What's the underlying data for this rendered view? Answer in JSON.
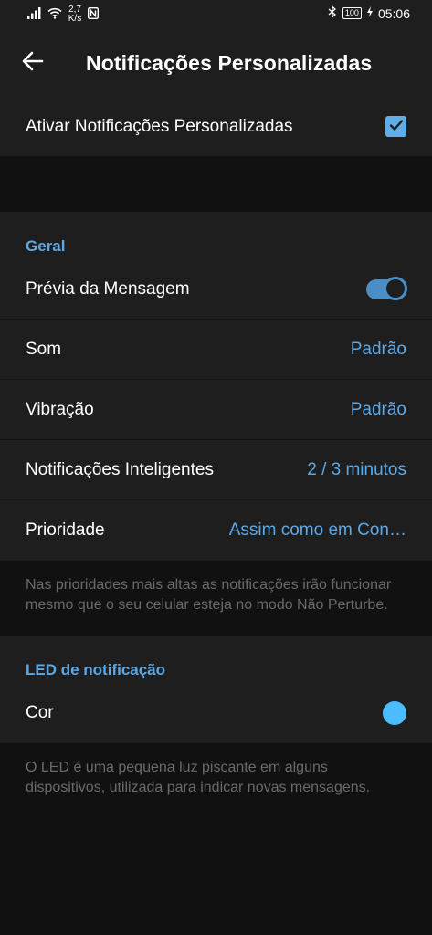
{
  "status": {
    "net_speed_value": "2,7",
    "net_speed_unit": "K/s",
    "battery": "100",
    "time": "05:06"
  },
  "header": {
    "title": "Notificações Personalizadas"
  },
  "enable_row": {
    "label": "Ativar Notificações Personalizadas",
    "checked": true
  },
  "general": {
    "header": "Geral",
    "preview_label": "Prévia da Mensagem",
    "preview_on": true,
    "sound_label": "Som",
    "sound_value": "Padrão",
    "vibration_label": "Vibração",
    "vibration_value": "Padrão",
    "smart_label": "Notificações Inteligentes",
    "smart_value": "2 / 3 minutos",
    "priority_label": "Prioridade",
    "priority_value": "Assim como em Con…",
    "info": "Nas prioridades mais altas as notificações irão funcionar mesmo que o seu celular esteja no modo Não Perturbe."
  },
  "led": {
    "header": "LED de notificação",
    "color_label": "Cor",
    "color_value": "#4bbcff",
    "info": "O LED é uma pequena luz piscante em alguns dispositivos, utilizada para indicar novas mensagens."
  },
  "colors": {
    "accent": "#5ea8e6",
    "surface": "#1e1e1e",
    "background": "#111111"
  }
}
